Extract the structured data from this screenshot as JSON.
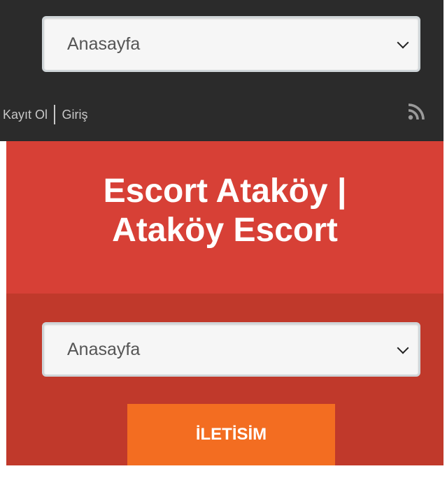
{
  "top_nav": {
    "select_value": "Anasayfa"
  },
  "user_links": {
    "register": "Kayıt Ol",
    "login": "Giriş"
  },
  "icons": {
    "rss": "rss-icon",
    "select_arrow": "chevron-down-icon"
  },
  "header": {
    "title_line1": "Escort Ataköy |",
    "title_line2": "Ataköy Escort"
  },
  "menu": {
    "select_value": "Anasayfa",
    "contact_button": "İLETİSİM"
  },
  "colors": {
    "topbar": "#2b2b2b",
    "title_band": "#d74036",
    "menu_band": "#c0392b",
    "button": "#f36d21"
  }
}
